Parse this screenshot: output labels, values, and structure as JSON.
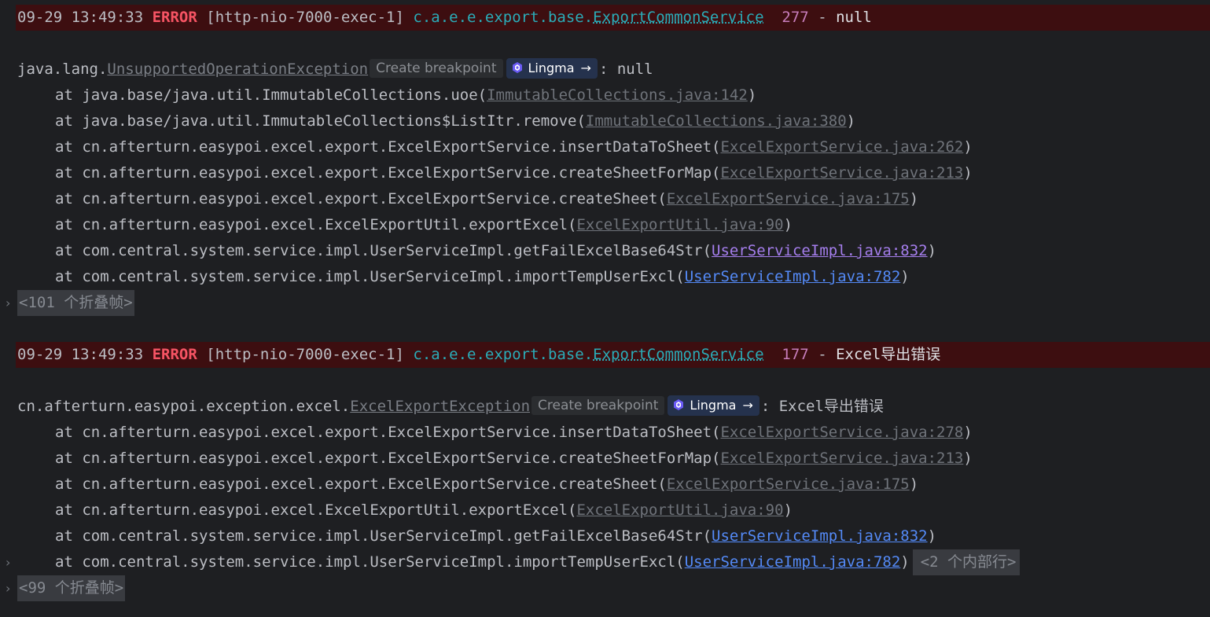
{
  "log1": {
    "timestamp": "09-29 13:49:33",
    "level": "ERROR",
    "thread": "[http-nio-7000-exec-1]",
    "logger_pkg": "c.a.e.e.export.base.",
    "logger_cls": "ExportCommonService",
    "lineno": "277",
    "sep": "-",
    "message": "null"
  },
  "exc1": {
    "pkg": "java.lang.",
    "cls": "UnsupportedOperationException",
    "breakpoint": "Create breakpoint",
    "lingma": "Lingma",
    "tail": ": null",
    "frames": [
      {
        "at": "at java.base/java.util.ImmutableCollections.uoe(",
        "loc": "ImmutableCollections.java:142",
        "end": ")"
      },
      {
        "at": "at java.base/java.util.ImmutableCollections$ListItr.remove(",
        "loc": "ImmutableCollections.java:380",
        "end": ")"
      },
      {
        "at": "at cn.afterturn.easypoi.excel.export.ExcelExportService.insertDataToSheet(",
        "loc": "ExcelExportService.java:262",
        "end": ")"
      },
      {
        "at": "at cn.afterturn.easypoi.excel.export.ExcelExportService.createSheetForMap(",
        "loc": "ExcelExportService.java:213",
        "end": ")"
      },
      {
        "at": "at cn.afterturn.easypoi.excel.export.ExcelExportService.createSheet(",
        "loc": "ExcelExportService.java:175",
        "end": ")"
      },
      {
        "at": "at cn.afterturn.easypoi.excel.ExcelExportUtil.exportExcel(",
        "loc": "ExcelExportUtil.java:90",
        "end": ")"
      },
      {
        "at": "at com.central.system.service.impl.UserServiceImpl.getFailExcelBase64Str(",
        "loc": "UserServiceImpl.java:832",
        "end": ")"
      },
      {
        "at": "at com.central.system.service.impl.UserServiceImpl.importTempUserExcl(",
        "loc": "UserServiceImpl.java:782",
        "end": ")"
      }
    ],
    "folded": "<101 个折叠帧>"
  },
  "log2": {
    "timestamp": "09-29 13:49:33",
    "level": "ERROR",
    "thread": "[http-nio-7000-exec-1]",
    "logger_pkg": "c.a.e.e.export.base.",
    "logger_cls": "ExportCommonService",
    "lineno": "177",
    "sep": "-",
    "message": "Excel导出错误"
  },
  "exc2": {
    "pkg": "cn.afterturn.easypoi.exception.excel.",
    "cls": "ExcelExportException",
    "breakpoint": "Create breakpoint",
    "lingma": "Lingma",
    "tail": ": Excel导出错误",
    "frames": [
      {
        "at": "at cn.afterturn.easypoi.excel.export.ExcelExportService.insertDataToSheet(",
        "loc": "ExcelExportService.java:278",
        "end": ")"
      },
      {
        "at": "at cn.afterturn.easypoi.excel.export.ExcelExportService.createSheetForMap(",
        "loc": "ExcelExportService.java:213",
        "end": ")"
      },
      {
        "at": "at cn.afterturn.easypoi.excel.export.ExcelExportService.createSheet(",
        "loc": "ExcelExportService.java:175",
        "end": ")"
      },
      {
        "at": "at cn.afterturn.easypoi.excel.ExcelExportUtil.exportExcel(",
        "loc": "ExcelExportUtil.java:90",
        "end": ")"
      },
      {
        "at": "at com.central.system.service.impl.UserServiceImpl.getFailExcelBase64Str(",
        "loc": "UserServiceImpl.java:832",
        "end": ")"
      },
      {
        "at": "at com.central.system.service.impl.UserServiceImpl.importTempUserExcl(",
        "loc": "UserServiceImpl.java:782",
        "end": ")"
      }
    ],
    "inner_folded": "<2 个内部行>",
    "folded": "<99 个折叠帧>"
  },
  "colors": {
    "background": "#1e1f22",
    "error_row": "#3d0e10",
    "error_level": "#f75464",
    "logger": "#2aacb8",
    "lineno": "#c77dbb",
    "user_link": "#548af7",
    "user_link_visited": "#a57eed",
    "lingma_bg": "#25324d"
  },
  "icons": {
    "lingma": "lingma-logo-icon",
    "arrow": "arrow-right-icon",
    "fold": "chevron-right-icon"
  }
}
